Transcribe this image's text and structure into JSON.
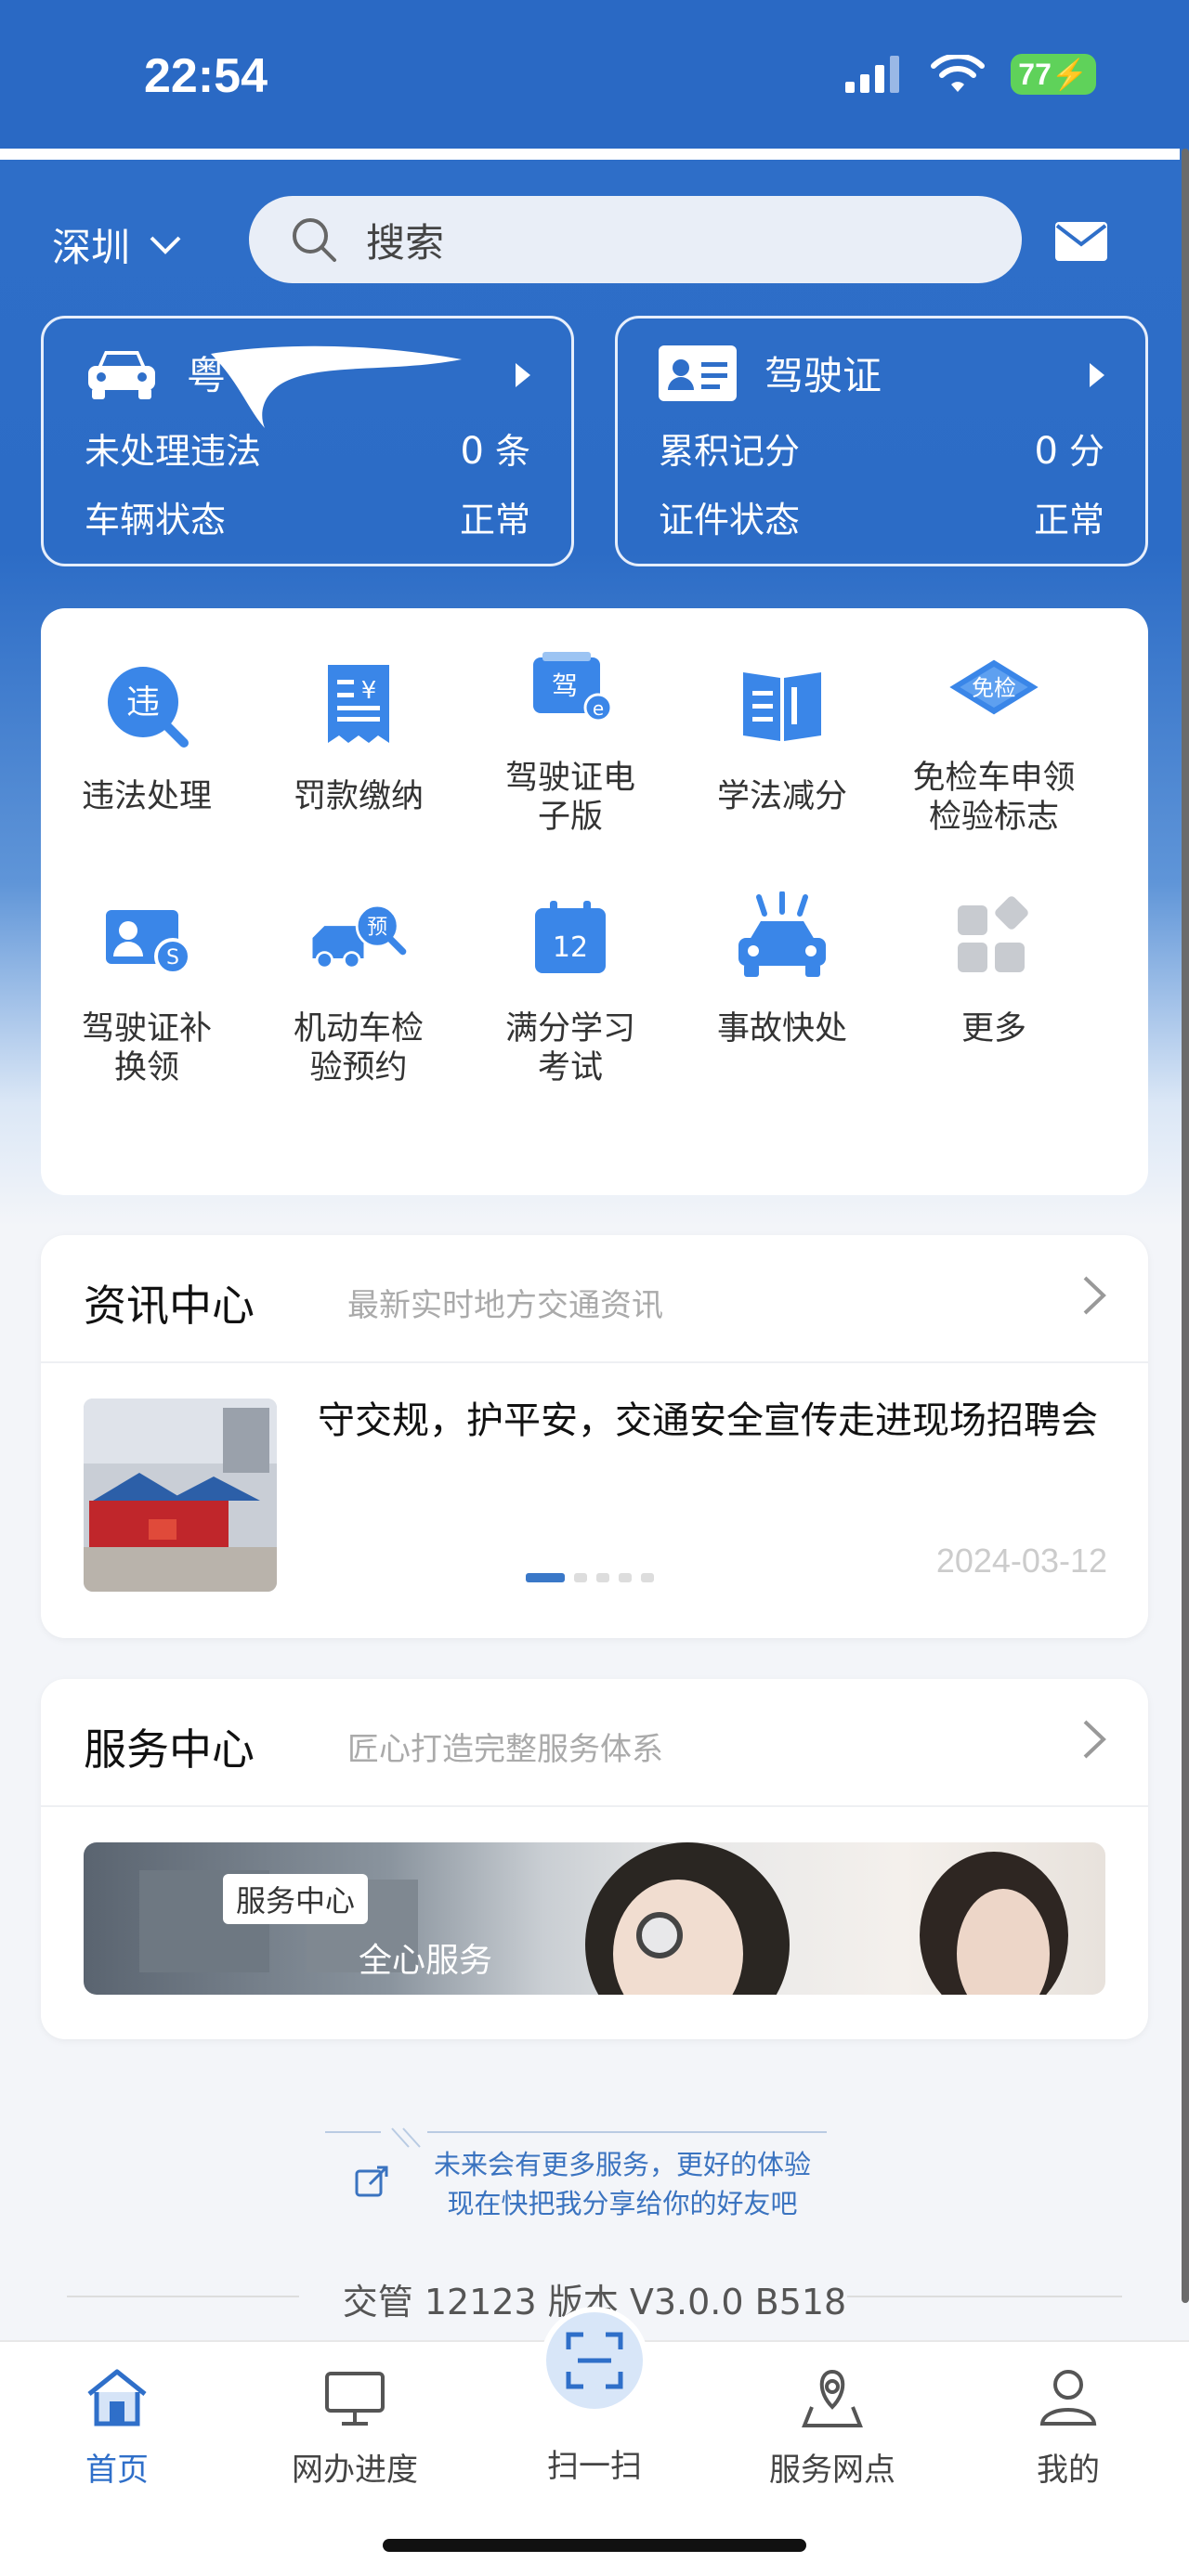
{
  "status_bar": {
    "time": "22:54",
    "battery": "77"
  },
  "header": {
    "city": "深圳",
    "search_placeholder": "搜索"
  },
  "vehicle_card": {
    "plate": "粤",
    "row1_label": "未处理违法",
    "row1_value": "0",
    "row1_unit": "条",
    "row2_label": "车辆状态",
    "row2_value": "正常"
  },
  "license_card": {
    "title": "驾驶证",
    "row1_label": "累积记分",
    "row1_value": "0",
    "row1_unit": "分",
    "row2_label": "证件状态",
    "row2_value": "正常"
  },
  "grid": [
    {
      "label": "违法处理",
      "icon": "violation-icon"
    },
    {
      "label": "罚款缴纳",
      "icon": "fine-payment-icon"
    },
    {
      "label": "驾驶证电\n子版",
      "icon": "e-license-icon"
    },
    {
      "label": "学法减分",
      "icon": "study-book-icon"
    },
    {
      "label": "免检车申领\n检验标志",
      "icon": "exempt-inspection-icon"
    },
    {
      "label": "驾驶证补\n换领",
      "icon": "license-renew-icon"
    },
    {
      "label": "机动车检\n验预约",
      "icon": "inspection-booking-icon"
    },
    {
      "label": "满分学习\n考试",
      "icon": "calendar-12-icon"
    },
    {
      "label": "事故快处",
      "icon": "accident-icon"
    },
    {
      "label": "更多",
      "icon": "more-grid-icon"
    }
  ],
  "icon_text": {
    "violation": "违",
    "fine": "¥",
    "license": "驾",
    "exempt": "免检",
    "renew_badge": "S",
    "booking": "预",
    "calendar": "12"
  },
  "news": {
    "title": "资讯中心",
    "subtitle": "最新实时地方交通资讯",
    "headline": "守交规，护平安，交通安全宣传走进现场招聘会",
    "date": "2024-03-12",
    "carousel_index": 1,
    "carousel_count": 5
  },
  "service": {
    "title": "服务中心",
    "subtitle": "匠心打造完整服务体系",
    "banner_tag": "服务中心",
    "banner_text": "全心服务"
  },
  "share": {
    "line1": "未来会有更多服务，更好的体验",
    "line2": "现在快把我分享给你的好友吧"
  },
  "version": "交管 12123 版本 V3.0.0 B518",
  "tabs": [
    {
      "label": "首页",
      "active": true
    },
    {
      "label": "网办进度"
    },
    {
      "label": "扫一扫"
    },
    {
      "label": "服务网点"
    },
    {
      "label": "我的"
    }
  ],
  "colors": {
    "primary": "#2f6fc9",
    "icon_blue": "#3a86e8",
    "battery": "#5fd25a"
  }
}
